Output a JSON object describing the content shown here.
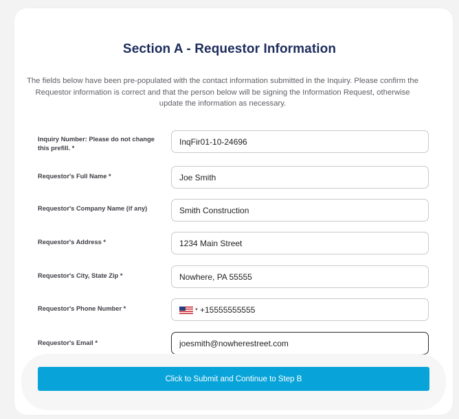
{
  "section": {
    "title": "Section A - Requestor Information",
    "intro": "The fields below have been pre-populated with the contact information submitted in the Inquiry. Please confirm the Requestor information is correct and that the person below will be signing the Information Request, otherwise update the information as necessary."
  },
  "fields": {
    "inquiry_number": {
      "label": "Inquiry Number: Please do not change this prefill. *",
      "value": "InqFir01-10-24696"
    },
    "full_name": {
      "label": "Requestor's Full Name *",
      "value": "Joe Smith"
    },
    "company_name": {
      "label": "Requestor's Company Name (if any)",
      "value": "Smith Construction"
    },
    "address": {
      "label": "Requestor's Address *",
      "value": "1234 Main Street"
    },
    "city_state_zip": {
      "label": "Requestor's City, State Zip *",
      "value": "Nowhere, PA 55555"
    },
    "phone": {
      "label": "Requestor's Phone Number *",
      "country_flag": "us-flag-icon",
      "value": "+15555555555"
    },
    "email": {
      "label": "Requestor's Email *",
      "value": "joesmith@nowherestreet.com"
    }
  },
  "submit": {
    "label": "Click to Submit and Continue to Step B"
  },
  "colors": {
    "title": "#1c2c5c",
    "button": "#08a4d9"
  }
}
